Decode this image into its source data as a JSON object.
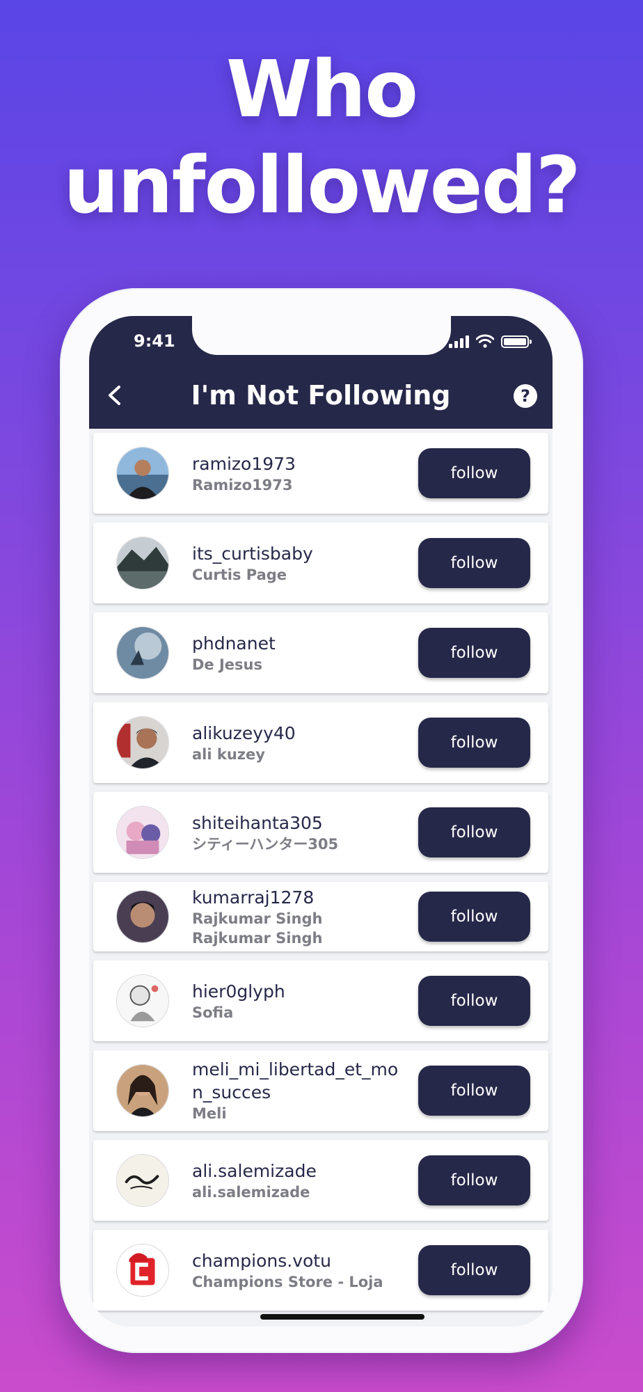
{
  "promo": {
    "headline_line1": "Who",
    "headline_line2": "unfollowed?"
  },
  "status_bar": {
    "time": "9:41",
    "icons": [
      "signal-icon",
      "wifi-icon",
      "battery-icon"
    ]
  },
  "header": {
    "title": "I'm Not Following",
    "back_icon": "chevron-left-icon",
    "help_icon": "question-icon",
    "help_glyph": "?"
  },
  "colors": {
    "header_bg": "#262849",
    "button_bg": "#262849",
    "background_top": "#5a45e6",
    "background_bottom": "#c94ccc"
  },
  "follow_label": "follow",
  "users": [
    {
      "username": "ramizo1973",
      "fullname": "Ramizo1973",
      "fullname2": ""
    },
    {
      "username": "its_curtisbaby",
      "fullname": "Curtis Page",
      "fullname2": ""
    },
    {
      "username": "phdnanet",
      "fullname": "De Jesus",
      "fullname2": ""
    },
    {
      "username": "alikuzeyy40",
      "fullname": "ali kuzey",
      "fullname2": ""
    },
    {
      "username": "shiteihanta305",
      "fullname": "シティーハンター305",
      "fullname2": ""
    },
    {
      "username": "kumarraj1278",
      "fullname": "Rajkumar Singh",
      "fullname2": "Rajkumar Singh"
    },
    {
      "username": "hier0glyph",
      "fullname": "Sofia",
      "fullname2": ""
    },
    {
      "username": "meli_mi_libertad_et_mon_succes",
      "fullname": "Meli",
      "fullname2": ""
    },
    {
      "username": "ali.salemizade",
      "fullname": "ali.salemizade",
      "fullname2": ""
    },
    {
      "username": "champions.votu",
      "fullname": "Champions Store - Loja",
      "fullname2": ""
    }
  ]
}
